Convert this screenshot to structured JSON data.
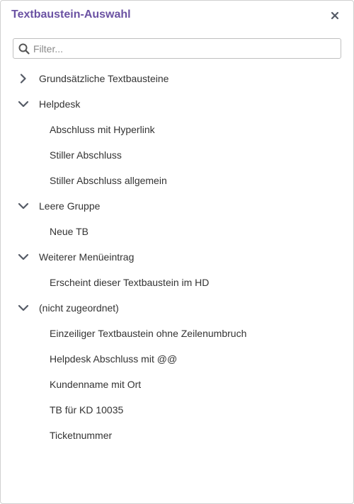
{
  "dialog": {
    "title": "Textbaustein-Auswahl",
    "close_icon": "close-icon",
    "accent_color": "#6b52a3"
  },
  "search": {
    "placeholder": "Filter...",
    "value": "",
    "icon": "search-icon"
  },
  "tree": {
    "groups": [
      {
        "label": "Grundsätzliche Textbausteine",
        "expanded": false,
        "items": []
      },
      {
        "label": "Helpdesk",
        "expanded": true,
        "items": [
          "Abschluss mit Hyperlink",
          "Stiller Abschluss",
          "Stiller Abschluss allgemein"
        ]
      },
      {
        "label": "Leere Gruppe",
        "expanded": true,
        "items": [
          "Neue TB"
        ]
      },
      {
        "label": "Weiterer Menüeintrag",
        "expanded": true,
        "items": [
          "Erscheint dieser Textbaustein im HD"
        ]
      },
      {
        "label": "(nicht zugeordnet)",
        "expanded": true,
        "items": [
          "Einzeiliger Textbaustein ohne Zeilenumbruch",
          "Helpdesk Abschluss mit @@",
          "Kundenname mit Ort",
          "TB für KD 10035",
          "Ticketnummer"
        ]
      }
    ]
  }
}
